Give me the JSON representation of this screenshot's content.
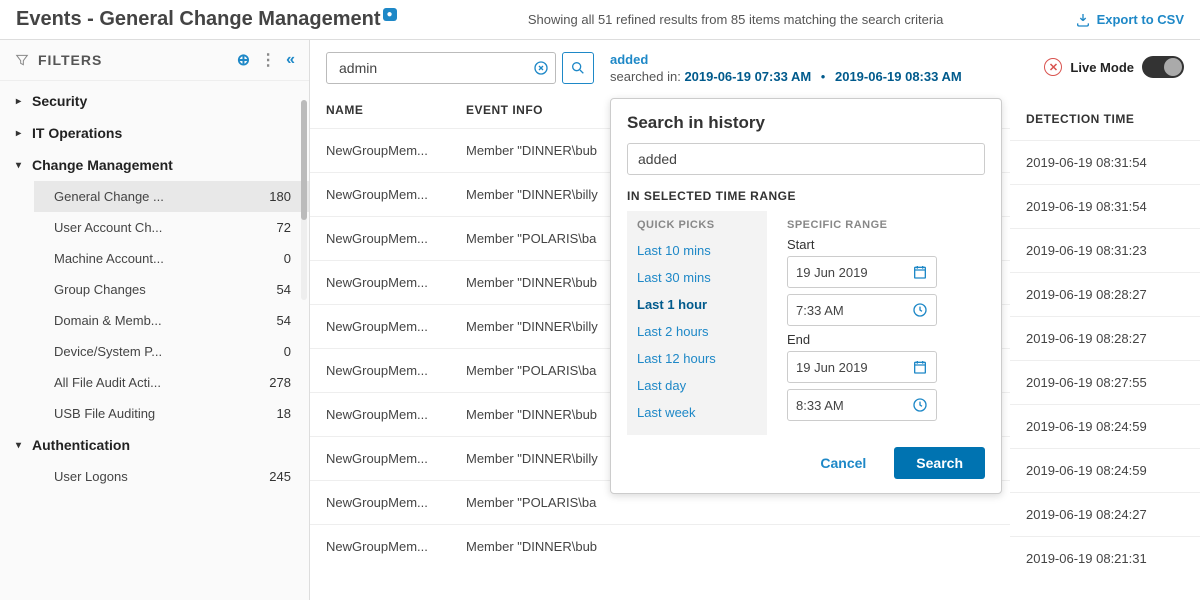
{
  "header": {
    "title": "Events - General Change Management",
    "badge": "",
    "info": "Showing all 51 refined results from 85 items matching the search criteria",
    "export_label": "Export to CSV"
  },
  "sidebar": {
    "filters_title": "FILTERS",
    "sections": [
      {
        "label": "Security",
        "expanded": false
      },
      {
        "label": "IT Operations",
        "expanded": false
      },
      {
        "label": "Change Management",
        "expanded": true
      },
      {
        "label": "Authentication",
        "expanded": true
      }
    ],
    "change_mgmt_items": [
      {
        "label": "General Change ...",
        "count": "180",
        "selected": true
      },
      {
        "label": "User Account Ch...",
        "count": "72",
        "selected": false
      },
      {
        "label": "Machine Account...",
        "count": "0",
        "selected": false
      },
      {
        "label": "Group Changes",
        "count": "54",
        "selected": false
      },
      {
        "label": "Domain & Memb...",
        "count": "54",
        "selected": false
      },
      {
        "label": "Device/System P...",
        "count": "0",
        "selected": false
      },
      {
        "label": "All File Audit Acti...",
        "count": "278",
        "selected": false
      },
      {
        "label": "USB File Auditing",
        "count": "18",
        "selected": false
      }
    ],
    "auth_items": [
      {
        "label": "User Logons",
        "count": "245",
        "selected": false
      }
    ]
  },
  "toolbar": {
    "search_value": "admin",
    "searched_term": "added",
    "searched_in_label": "searched in:",
    "date_from": "2019-06-19 07:33 AM",
    "date_to": "2019-06-19 08:33 AM",
    "live_mode_label": "Live Mode"
  },
  "table": {
    "columns": {
      "name": "NAME",
      "info": "EVENT INFO",
      "time": "DETECTION TIME"
    },
    "rows": [
      {
        "name": "NewGroupMem...",
        "info": "Member \"DINNER\\bub",
        "time": "2019-06-19 08:31:54"
      },
      {
        "name": "NewGroupMem...",
        "info": "Member \"DINNER\\billy",
        "time": "2019-06-19 08:31:54"
      },
      {
        "name": "NewGroupMem...",
        "info": "Member \"POLARIS\\ba",
        "time": "2019-06-19 08:31:23"
      },
      {
        "name": "NewGroupMem...",
        "info": "Member \"DINNER\\bub",
        "time": "2019-06-19 08:28:27"
      },
      {
        "name": "NewGroupMem...",
        "info": "Member \"DINNER\\billy",
        "time": "2019-06-19 08:28:27"
      },
      {
        "name": "NewGroupMem...",
        "info": "Member \"POLARIS\\ba",
        "time": "2019-06-19 08:27:55"
      },
      {
        "name": "NewGroupMem...",
        "info": "Member \"DINNER\\bub",
        "time": "2019-06-19 08:24:59"
      },
      {
        "name": "NewGroupMem...",
        "info": "Member \"DINNER\\billy",
        "time": "2019-06-19 08:24:59"
      },
      {
        "name": "NewGroupMem...",
        "info": "Member \"POLARIS\\ba",
        "time": "2019-06-19 08:24:27"
      },
      {
        "name": "NewGroupMem...",
        "info": "Member \"DINNER\\bub",
        "time": "2019-06-19 08:21:31"
      }
    ]
  },
  "popover": {
    "title": "Search in history",
    "input_value": "added",
    "section_label": "IN SELECTED TIME RANGE",
    "quick_picks_title": "QUICK PICKS",
    "specific_title": "SPECIFIC RANGE",
    "picks": [
      {
        "label": "Last 10 mins",
        "selected": false
      },
      {
        "label": "Last 30 mins",
        "selected": false
      },
      {
        "label": "Last 1 hour",
        "selected": true
      },
      {
        "label": "Last 2 hours",
        "selected": false
      },
      {
        "label": "Last 12 hours",
        "selected": false
      },
      {
        "label": "Last day",
        "selected": false
      },
      {
        "label": "Last week",
        "selected": false
      }
    ],
    "start_label": "Start",
    "end_label": "End",
    "start_date": "19 Jun 2019",
    "start_time": "7:33 AM",
    "end_date": "19 Jun 2019",
    "end_time": "8:33 AM",
    "cancel_label": "Cancel",
    "search_label": "Search"
  }
}
